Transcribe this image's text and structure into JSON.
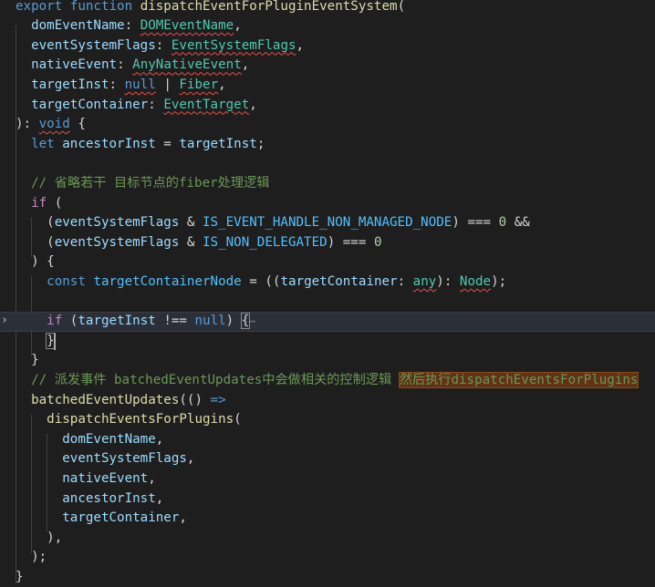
{
  "editor": {
    "colors": {
      "background": "#1e1e1e",
      "keyword": "#569cd6",
      "control": "#c586c0",
      "function": "#dcdcaa",
      "variable": "#9cdcfe",
      "type": "#4ec9b0",
      "constant": "#4fc1ff",
      "number": "#b5cea8",
      "comment": "#6a9955",
      "find_highlight": "#613214"
    },
    "lines": [
      [
        [
          "kw",
          "export"
        ],
        [
          "plain",
          " "
        ],
        [
          "kw",
          "function"
        ],
        [
          "plain",
          " "
        ],
        [
          "fn",
          "dispatchEventForPluginEventSystem"
        ],
        [
          "plain",
          "("
        ]
      ],
      [
        [
          "plain",
          "  "
        ],
        [
          "var",
          "domEventName"
        ],
        [
          "plain",
          ": "
        ],
        [
          "type",
          "DOMEventName"
        ],
        [
          "plain",
          ","
        ]
      ],
      [
        [
          "plain",
          "  "
        ],
        [
          "var",
          "eventSystemFlags"
        ],
        [
          "plain",
          ": "
        ],
        [
          "type",
          "EventSystemFlags"
        ],
        [
          "plain",
          ","
        ]
      ],
      [
        [
          "plain",
          "  "
        ],
        [
          "var",
          "nativeEvent"
        ],
        [
          "plain",
          ": "
        ],
        [
          "type",
          "AnyNativeEvent"
        ],
        [
          "plain",
          ","
        ]
      ],
      [
        [
          "plain",
          "  "
        ],
        [
          "var",
          "targetInst"
        ],
        [
          "plain",
          ": "
        ],
        [
          "kw",
          "null"
        ],
        [
          "plain",
          " | "
        ],
        [
          "type",
          "Fiber"
        ],
        [
          "plain",
          ","
        ]
      ],
      [
        [
          "plain",
          "  "
        ],
        [
          "var",
          "targetContainer"
        ],
        [
          "plain",
          ": "
        ],
        [
          "type",
          "EventTarget"
        ],
        [
          "plain",
          ","
        ]
      ],
      [
        [
          "plain",
          "): "
        ],
        [
          "kw",
          "void"
        ],
        [
          "plain",
          " {"
        ]
      ],
      [
        [
          "plain",
          "  "
        ],
        [
          "kw",
          "let"
        ],
        [
          "plain",
          " "
        ],
        [
          "var",
          "ancestorInst"
        ],
        [
          "plain",
          " = "
        ],
        [
          "var",
          "targetInst"
        ],
        [
          "plain",
          ";"
        ]
      ],
      [],
      [
        [
          "plain",
          "  "
        ],
        [
          "cm",
          "// 省略若干 目标节点的fiber处理逻辑"
        ]
      ],
      [
        [
          "plain",
          "  "
        ],
        [
          "ctl",
          "if"
        ],
        [
          "plain",
          " ("
        ]
      ],
      [
        [
          "plain",
          "    ("
        ],
        [
          "var",
          "eventSystemFlags"
        ],
        [
          "plain",
          " & "
        ],
        [
          "const",
          "IS_EVENT_HANDLE_NON_MANAGED_NODE"
        ],
        [
          "plain",
          ") === "
        ],
        [
          "num",
          "0"
        ],
        [
          "plain",
          " &&"
        ]
      ],
      [
        [
          "plain",
          "    ("
        ],
        [
          "var",
          "eventSystemFlags"
        ],
        [
          "plain",
          " & "
        ],
        [
          "const",
          "IS_NON_DELEGATED"
        ],
        [
          "plain",
          ") === "
        ],
        [
          "num",
          "0"
        ]
      ],
      [
        [
          "plain",
          "  ) {"
        ]
      ],
      [
        [
          "plain",
          "    "
        ],
        [
          "kw",
          "const"
        ],
        [
          "plain",
          " "
        ],
        [
          "const",
          "targetContainerNode"
        ],
        [
          "plain",
          " = (("
        ],
        [
          "var",
          "targetContainer"
        ],
        [
          "plain",
          ": "
        ],
        [
          "type",
          "any"
        ],
        [
          "plain",
          "): "
        ],
        [
          "type",
          "Node"
        ],
        [
          "plain",
          ");"
        ]
      ],
      [],
      [
        [
          "plain",
          "    "
        ],
        [
          "ctl",
          "if"
        ],
        [
          "plain",
          " ("
        ],
        [
          "var",
          "targetInst"
        ],
        [
          "plain",
          " !== "
        ],
        [
          "kw",
          "null"
        ],
        [
          "plain",
          ") "
        ],
        [
          "brk",
          "{"
        ],
        [
          "fold",
          "⋯"
        ]
      ],
      [
        [
          "plain",
          "    "
        ],
        [
          "brk",
          "}"
        ]
      ],
      [
        [
          "plain",
          "  }"
        ]
      ],
      [
        [
          "plain",
          "  "
        ],
        [
          "cm",
          "// 派发事件 batchedEventUpdates中会做相关的控制逻辑 "
        ],
        [
          "find",
          "然后执行dispatchEventsForPlugins"
        ]
      ],
      [
        [
          "plain",
          "  "
        ],
        [
          "fn",
          "batchedEventUpdates"
        ],
        [
          "plain",
          "(() "
        ],
        [
          "kw",
          "=>"
        ]
      ],
      [
        [
          "plain",
          "    "
        ],
        [
          "fn",
          "dispatchEventsForPlugins"
        ],
        [
          "plain",
          "("
        ]
      ],
      [
        [
          "plain",
          "      "
        ],
        [
          "var",
          "domEventName"
        ],
        [
          "plain",
          ","
        ]
      ],
      [
        [
          "plain",
          "      "
        ],
        [
          "var",
          "eventSystemFlags"
        ],
        [
          "plain",
          ","
        ]
      ],
      [
        [
          "plain",
          "      "
        ],
        [
          "var",
          "nativeEvent"
        ],
        [
          "plain",
          ","
        ]
      ],
      [
        [
          "plain",
          "      "
        ],
        [
          "var",
          "ancestorInst"
        ],
        [
          "plain",
          ","
        ]
      ],
      [
        [
          "plain",
          "      "
        ],
        [
          "var",
          "targetContainer"
        ],
        [
          "plain",
          ","
        ]
      ],
      [
        [
          "plain",
          "    ),"
        ]
      ],
      [
        [
          "plain",
          "  );"
        ]
      ],
      [
        [
          "plain",
          "}"
        ]
      ]
    ],
    "squiggle_words": [
      "DOMEventName",
      "EventSystemFlags",
      "AnyNativeEvent",
      "null",
      "Fiber",
      "EventTarget",
      "void",
      "any",
      "Node"
    ],
    "gutter": {
      "fold_arrow_icon": "chevron-right-icon",
      "fold_arrow_glyph": "›"
    }
  }
}
